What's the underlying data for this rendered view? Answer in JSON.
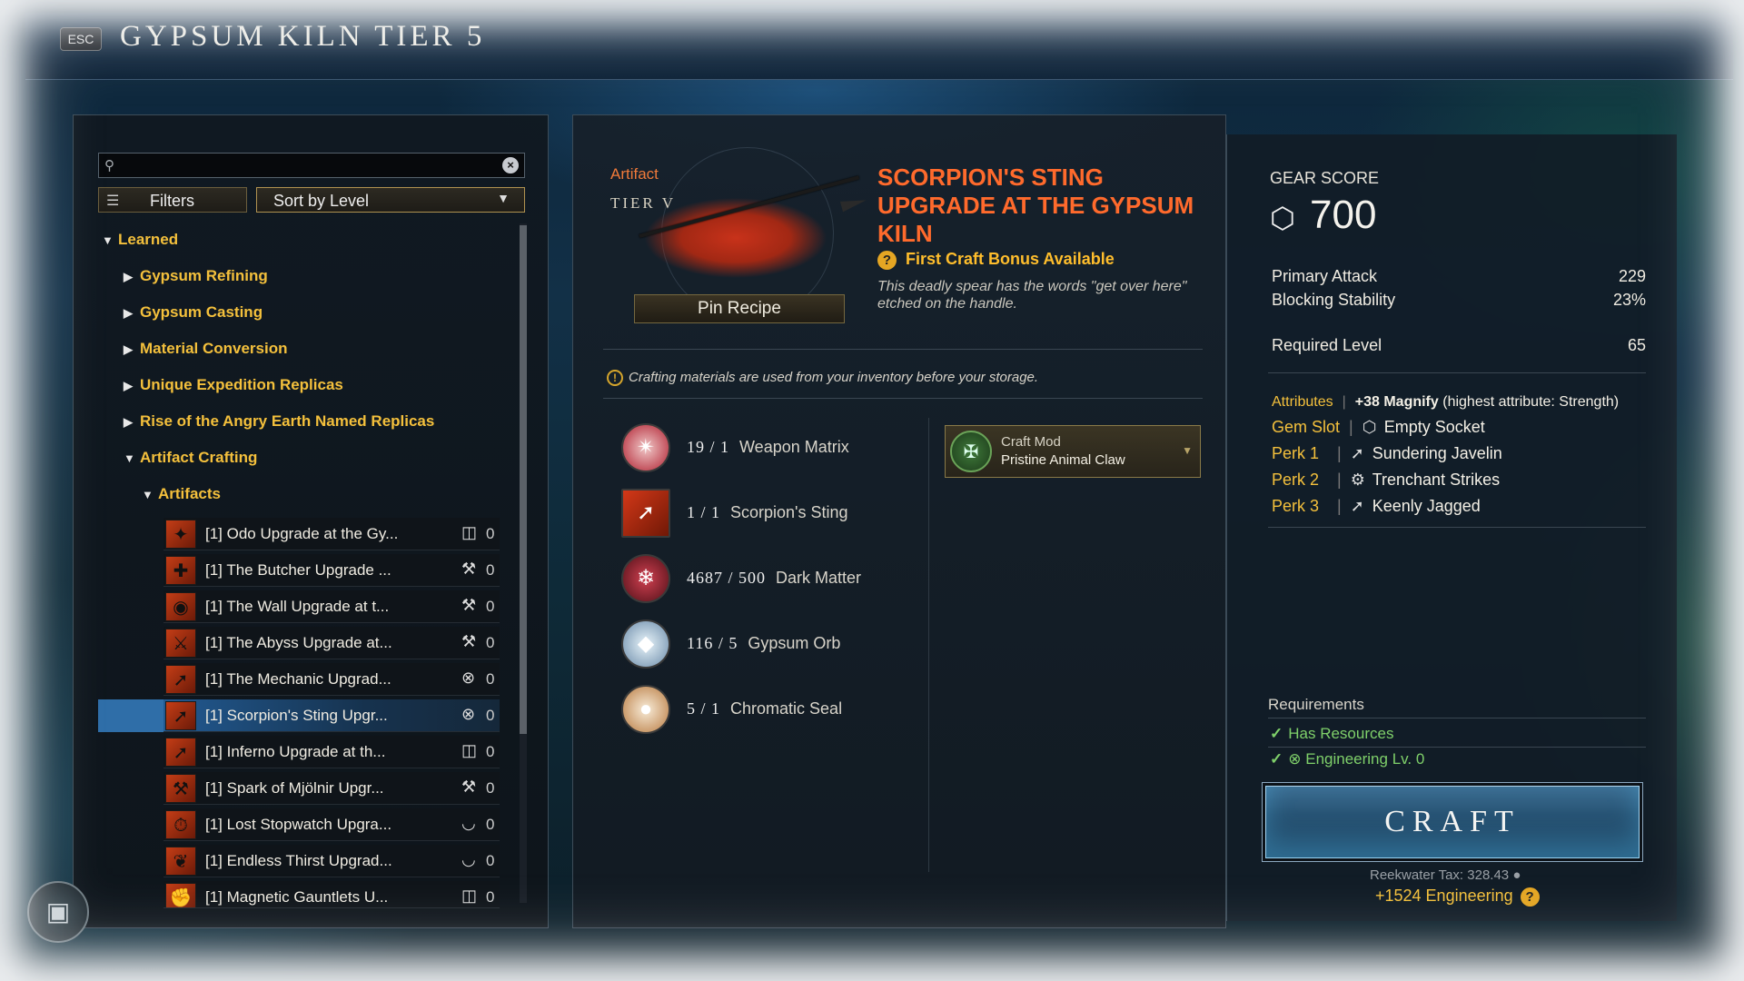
{
  "header": {
    "esc_label": "ESC",
    "title": "GYPSUM KILN TIER 5"
  },
  "search": {
    "placeholder": "",
    "value": ""
  },
  "toolbar": {
    "filters_label": "Filters",
    "sort_label": "Sort by Level"
  },
  "tree": {
    "learned": "Learned",
    "categories": [
      "Gypsum Refining",
      "Gypsum Casting",
      "Material Conversion",
      "Unique Expedition Replicas",
      "Rise of the Angry Earth Named Replicas",
      "Artifact Crafting"
    ],
    "subcategory": "Artifacts"
  },
  "recipes": [
    {
      "name": "[1] Odo Upgrade at the Gy...",
      "skill_icon": "armoring-icon",
      "count": "0"
    },
    {
      "name": "[1] The Butcher Upgrade ...",
      "skill_icon": "weaponsmithing-icon",
      "count": "0"
    },
    {
      "name": "[1] The Wall Upgrade at t...",
      "skill_icon": "weaponsmithing-icon",
      "count": "0"
    },
    {
      "name": "[1] The Abyss Upgrade at...",
      "skill_icon": "weaponsmithing-icon",
      "count": "0"
    },
    {
      "name": "[1] The Mechanic Upgrad...",
      "skill_icon": "engineering-icon",
      "count": "0"
    },
    {
      "name": "[1] Scorpion's Sting Upgr...",
      "skill_icon": "engineering-icon",
      "count": "0",
      "selected": true
    },
    {
      "name": "[1] Inferno Upgrade at th...",
      "skill_icon": "armoring-icon",
      "count": "0"
    },
    {
      "name": "[1] Spark of Mjölnir Upgr...",
      "skill_icon": "weaponsmithing-icon",
      "count": "0"
    },
    {
      "name": "[1] Lost Stopwatch Upgra...",
      "skill_icon": "jewelcrafting-icon",
      "count": "0"
    },
    {
      "name": "[1] Endless Thirst Upgrad...",
      "skill_icon": "jewelcrafting-icon",
      "count": "0"
    },
    {
      "name": "[1] Magnetic Gauntlets U...",
      "skill_icon": "armoring-icon",
      "count": "0"
    }
  ],
  "item": {
    "type": "Artifact",
    "tier": "TIER V",
    "pin_label": "Pin Recipe",
    "title": "SCORPION'S STING UPGRADE AT THE GYPSUM KILN",
    "bonus": "First Craft Bonus Available",
    "flavor": "This deadly spear has the words \"get over here\" etched on the handle."
  },
  "notice": "Crafting materials are used from your inventory before your storage.",
  "materials": [
    {
      "qty": "19 / 1",
      "name": "Weapon Matrix",
      "icon": "weapon-matrix-icon"
    },
    {
      "qty": "1 / 1",
      "name": "Scorpion's Sting",
      "icon": "scorpions-sting-icon"
    },
    {
      "qty": "4687 / 500",
      "name": "Dark Matter",
      "icon": "dark-matter-icon"
    },
    {
      "qty": "116 / 5",
      "name": "Gypsum Orb",
      "icon": "gypsum-orb-icon"
    },
    {
      "qty": "5 / 1",
      "name": "Chromatic Seal",
      "icon": "chromatic-seal-icon"
    }
  ],
  "craft_mod": {
    "label": "Craft Mod",
    "value": "Pristine Animal Claw"
  },
  "stats": {
    "gear_score_label": "GEAR SCORE",
    "gear_score": "700",
    "primary_attack_label": "Primary Attack",
    "primary_attack": "229",
    "blocking_label": "Blocking Stability",
    "blocking": "23%",
    "req_level_label": "Required Level",
    "req_level": "65",
    "attributes_label": "Attributes",
    "attributes_bold": "+38 Magnify",
    "attributes_rest": "(highest attribute: Strength)",
    "gem_label": "Gem Slot",
    "gem_value": "Empty Socket",
    "perk1_label": "Perk 1",
    "perk1": "Sundering Javelin",
    "perk2_label": "Perk 2",
    "perk2": "Trenchant Strikes",
    "perk3_label": "Perk 3",
    "perk3": "Keenly Jagged"
  },
  "requirements": {
    "label": "Requirements",
    "has_resources": "Has Resources",
    "engineering": "Engineering Lv. 0"
  },
  "craft": {
    "label": "CRAFT",
    "tax": "Reekwater Tax: 328.43",
    "xp": "+1524 Engineering"
  },
  "colors": {
    "accent_gold": "#f4c03c",
    "title_orange": "#ff6a2c",
    "ok_green": "#7fd06a",
    "craft_blue": "#275374"
  }
}
